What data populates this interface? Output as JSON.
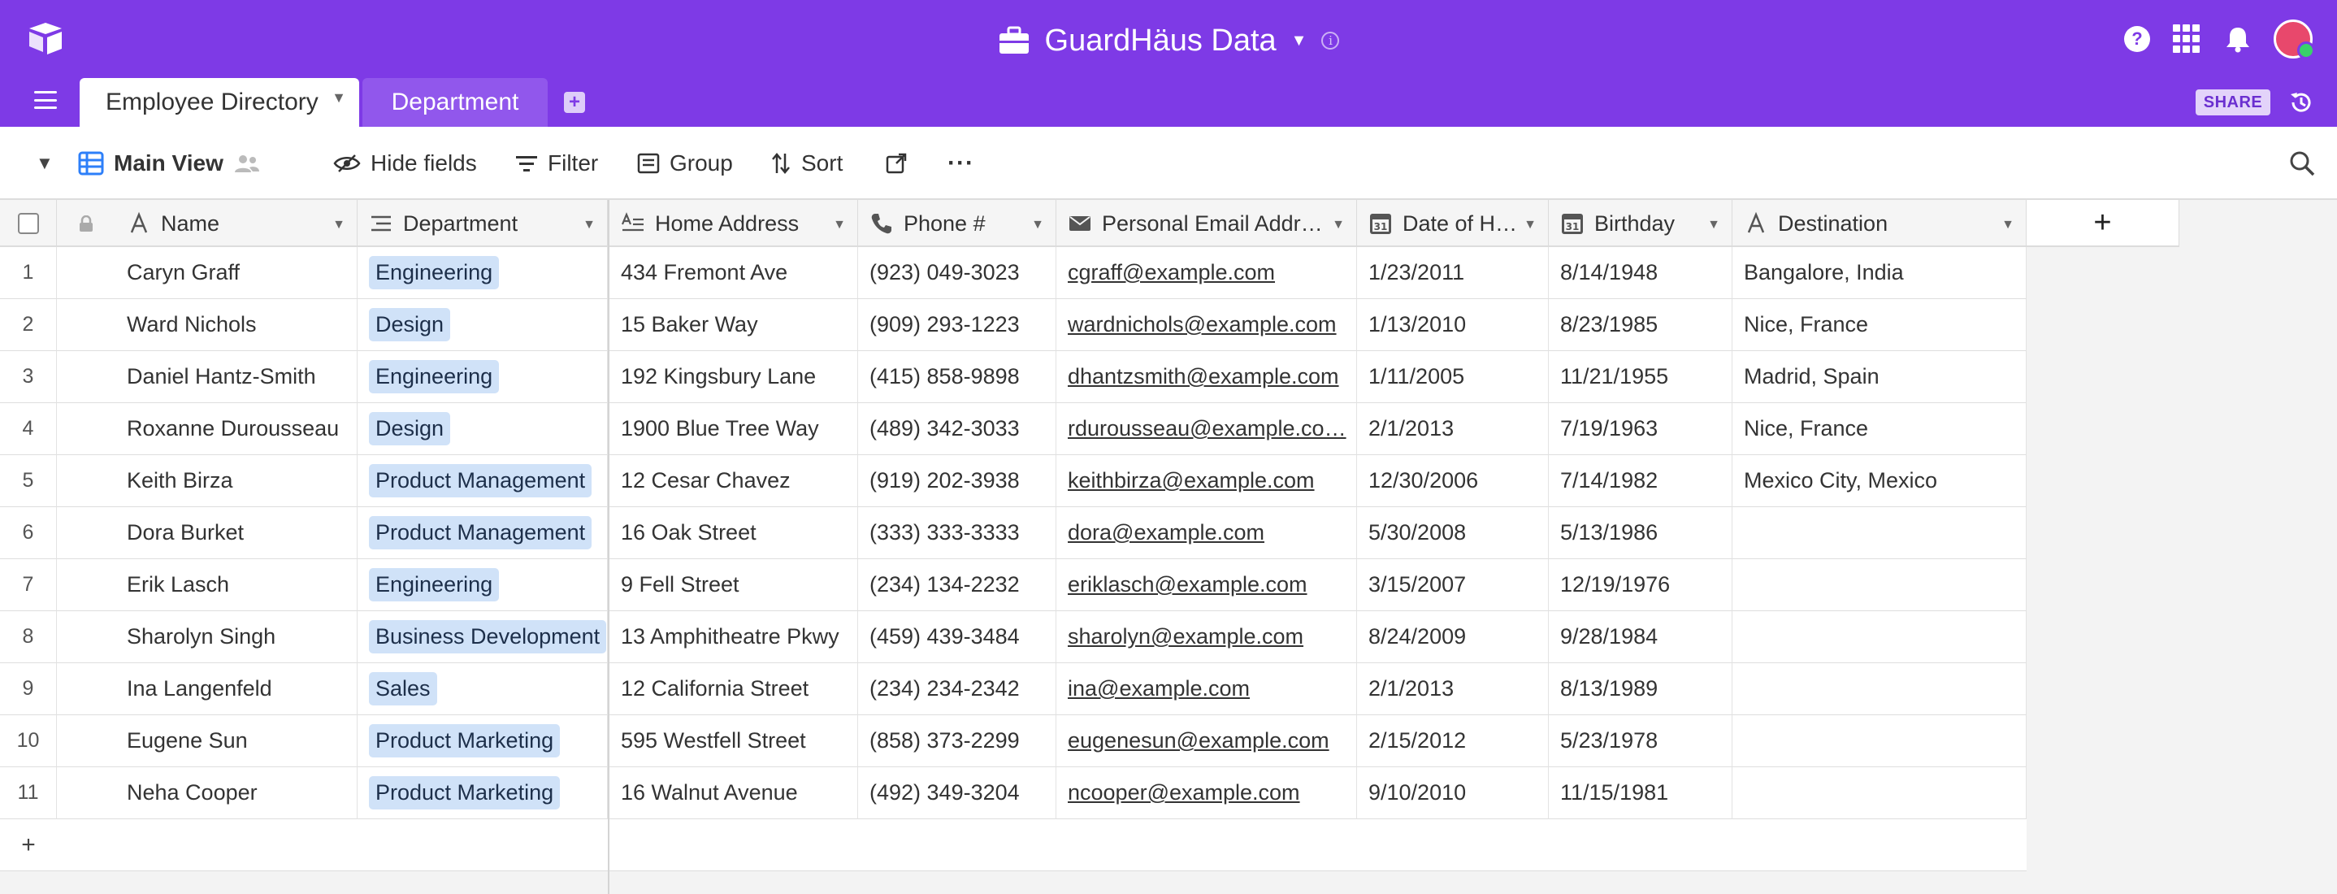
{
  "app": {
    "base_name": "GuardHäus Data",
    "brand_color": "#7e3ae6"
  },
  "tabs": [
    {
      "label": "Employee Directory",
      "active": true
    },
    {
      "label": "Department",
      "active": false
    }
  ],
  "header_actions": {
    "share_label": "SHARE",
    "icons": [
      "help-icon",
      "apps-icon",
      "bell-icon",
      "avatar",
      "history-icon"
    ]
  },
  "toolbar": {
    "view_name": "Main View",
    "hide_fields": "Hide fields",
    "filter": "Filter",
    "group": "Group",
    "sort": "Sort"
  },
  "columns": [
    {
      "key": "name",
      "label": "Name",
      "icon": "text-icon"
    },
    {
      "key": "department",
      "label": "Department",
      "icon": "link-icon"
    },
    {
      "key": "address",
      "label": "Home Address",
      "icon": "long-text-icon"
    },
    {
      "key": "phone",
      "label": "Phone #",
      "icon": "phone-icon"
    },
    {
      "key": "email",
      "label": "Personal Email Addr…",
      "icon": "email-icon"
    },
    {
      "key": "hire",
      "label": "Date of H…",
      "icon": "calendar-icon"
    },
    {
      "key": "birthday",
      "label": "Birthday",
      "icon": "calendar-icon"
    },
    {
      "key": "destination",
      "label": "Destination",
      "icon": "text-icon"
    }
  ],
  "rows": [
    {
      "n": "1",
      "name": "Caryn Graff",
      "department": "Engineering",
      "address": "434 Fremont Ave",
      "phone": "(923) 049-3023",
      "email": "cgraff@example.com",
      "hire": "1/23/2011",
      "birthday": "8/14/1948",
      "destination": "Bangalore, India"
    },
    {
      "n": "2",
      "name": "Ward Nichols",
      "department": "Design",
      "address": "15 Baker Way",
      "phone": "(909) 293-1223",
      "email": "wardnichols@example.com",
      "hire": "1/13/2010",
      "birthday": "8/23/1985",
      "destination": "Nice, France"
    },
    {
      "n": "3",
      "name": "Daniel Hantz-Smith",
      "department": "Engineering",
      "address": "192 Kingsbury Lane",
      "phone": "(415) 858-9898",
      "email": "dhantzsmith@example.com",
      "hire": "1/11/2005",
      "birthday": "11/21/1955",
      "destination": "Madrid, Spain"
    },
    {
      "n": "4",
      "name": "Roxanne Durousseau",
      "department": "Design",
      "address": "1900 Blue Tree Way",
      "phone": "(489) 342-3033",
      "email": "rdurousseau@example.co…",
      "hire": "2/1/2013",
      "birthday": "7/19/1963",
      "destination": "Nice, France"
    },
    {
      "n": "5",
      "name": "Keith Birza",
      "department": "Product Management",
      "address": "12 Cesar Chavez",
      "phone": "(919) 202-3938",
      "email": "keithbirza@example.com",
      "hire": "12/30/2006",
      "birthday": "7/14/1982",
      "destination": "Mexico City, Mexico"
    },
    {
      "n": "6",
      "name": "Dora Burket",
      "department": "Product Management",
      "address": "16 Oak Street",
      "phone": "(333) 333-3333",
      "email": "dora@example.com",
      "hire": "5/30/2008",
      "birthday": "5/13/1986",
      "destination": ""
    },
    {
      "n": "7",
      "name": "Erik Lasch",
      "department": "Engineering",
      "address": "9 Fell Street",
      "phone": "(234) 134-2232",
      "email": "eriklasch@example.com",
      "hire": "3/15/2007",
      "birthday": "12/19/1976",
      "destination": ""
    },
    {
      "n": "8",
      "name": "Sharolyn Singh",
      "department": "Business Development",
      "address": "13 Amphitheatre Pkwy",
      "phone": "(459) 439-3484",
      "email": "sharolyn@example.com",
      "hire": "8/24/2009",
      "birthday": "9/28/1984",
      "destination": ""
    },
    {
      "n": "9",
      "name": "Ina Langenfeld",
      "department": "Sales",
      "address": "12 California Street",
      "phone": "(234) 234-2342",
      "email": "ina@example.com",
      "hire": "2/1/2013",
      "birthday": "8/13/1989",
      "destination": ""
    },
    {
      "n": "10",
      "name": "Eugene Sun",
      "department": "Product Marketing",
      "address": "595 Westfell Street",
      "phone": "(858) 373-2299",
      "email": "eugenesun@example.com",
      "hire": "2/15/2012",
      "birthday": "5/23/1978",
      "destination": ""
    },
    {
      "n": "11",
      "name": "Neha Cooper",
      "department": "Product Marketing",
      "address": "16 Walnut Avenue",
      "phone": "(492) 349-3204",
      "email": "ncooper@example.com",
      "hire": "9/10/2010",
      "birthday": "11/15/1981",
      "destination": ""
    }
  ],
  "add_row_label": "+",
  "add_column_label": "+"
}
